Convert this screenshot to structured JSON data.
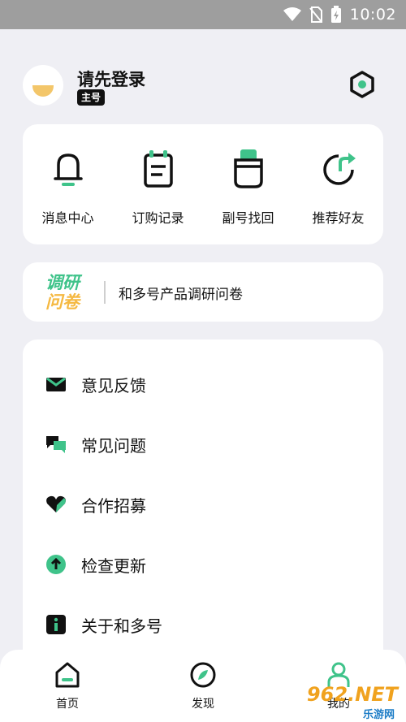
{
  "status_bar": {
    "time": "10:02"
  },
  "profile": {
    "title": "请先登录",
    "badge": "主号"
  },
  "quick_actions": [
    {
      "label": "消息中心",
      "icon": "bell-icon"
    },
    {
      "label": "订购记录",
      "icon": "notepad-icon"
    },
    {
      "label": "副号找回",
      "icon": "cup-icon"
    },
    {
      "label": "推荐好友",
      "icon": "share-arrow-icon"
    }
  ],
  "survey": {
    "logo_line1": "调研",
    "logo_line2": "问卷",
    "text": "和多号产品调研问卷"
  },
  "menu": [
    {
      "label": "意见反馈",
      "icon": "mail-icon"
    },
    {
      "label": "常见问题",
      "icon": "chat-bubbles-icon"
    },
    {
      "label": "合作招募",
      "icon": "heart-icon"
    },
    {
      "label": "检查更新",
      "icon": "upload-arrow-icon"
    },
    {
      "label": "关于和多号",
      "icon": "info-icon"
    }
  ],
  "bottom_nav": [
    {
      "label": "首页",
      "icon": "home-icon"
    },
    {
      "label": "发现",
      "icon": "compass-icon"
    },
    {
      "label": "我的",
      "icon": "person-icon"
    }
  ],
  "watermark": {
    "line1": "962.NET",
    "line2": "乐游网"
  },
  "colors": {
    "accent_green": "#3fc38a",
    "accent_yellow": "#f5b942",
    "background": "#efeff4"
  }
}
